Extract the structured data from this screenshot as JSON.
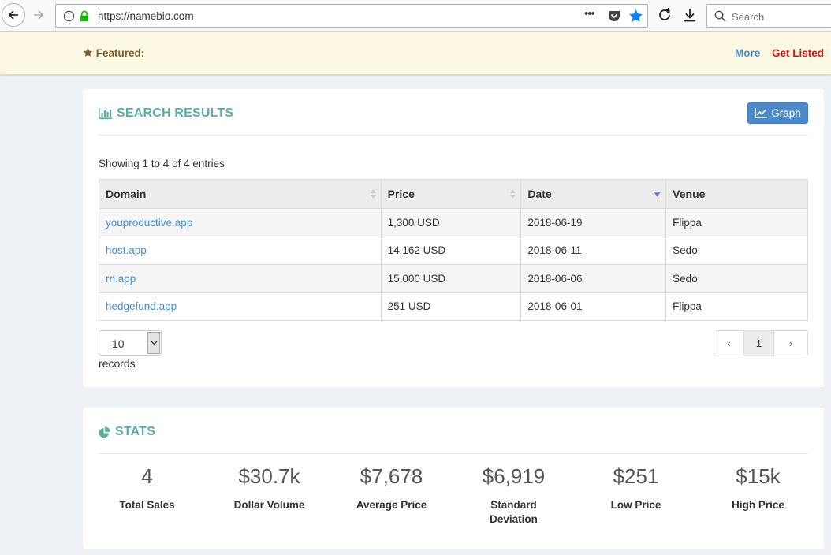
{
  "browser": {
    "url": "https://namebio.com",
    "search_placeholder": "Search",
    "url_more": "•••"
  },
  "featured": {
    "label": "Featured",
    "suffix": ":",
    "more": "More",
    "get_listed": "Get Listed"
  },
  "results": {
    "title": "SEARCH RESULTS",
    "graph_button": "Graph",
    "showing": "Showing 1 to 4 of 4 entries",
    "columns": [
      "Domain",
      "Price",
      "Date",
      "Venue"
    ],
    "rows": [
      {
        "domain": "youproductive.app",
        "price": "1,300 USD",
        "date": "2018-06-19",
        "venue": "Flippa"
      },
      {
        "domain": "host.app",
        "price": "14,162 USD",
        "date": "2018-06-11",
        "venue": "Sedo"
      },
      {
        "domain": "rn.app",
        "price": "15,000 USD",
        "date": "2018-06-06",
        "venue": "Sedo"
      },
      {
        "domain": "hedgefund.app",
        "price": "251 USD",
        "date": "2018-06-01",
        "venue": "Flippa"
      }
    ],
    "page_length": "10",
    "records_label": "records",
    "pagination": {
      "prev": "‹",
      "current": "1",
      "next": "›"
    }
  },
  "stats": {
    "title": "STATS",
    "items": [
      {
        "value": "4",
        "label": "Total Sales"
      },
      {
        "value": "$30.7k",
        "label": "Dollar Volume"
      },
      {
        "value": "$7,678",
        "label": "Average Price"
      },
      {
        "value": "$6,919",
        "label": "Standard Deviation"
      },
      {
        "value": "$251",
        "label": "Low Price"
      },
      {
        "value": "$15k",
        "label": "High Price"
      }
    ]
  },
  "colors": {
    "accent_teal": "#5aae9b",
    "link_blue": "#4a90c8",
    "get_listed_red": "#d9140f",
    "banner_bg": "#fcf8e3",
    "graph_button": "#4a8ac9"
  }
}
